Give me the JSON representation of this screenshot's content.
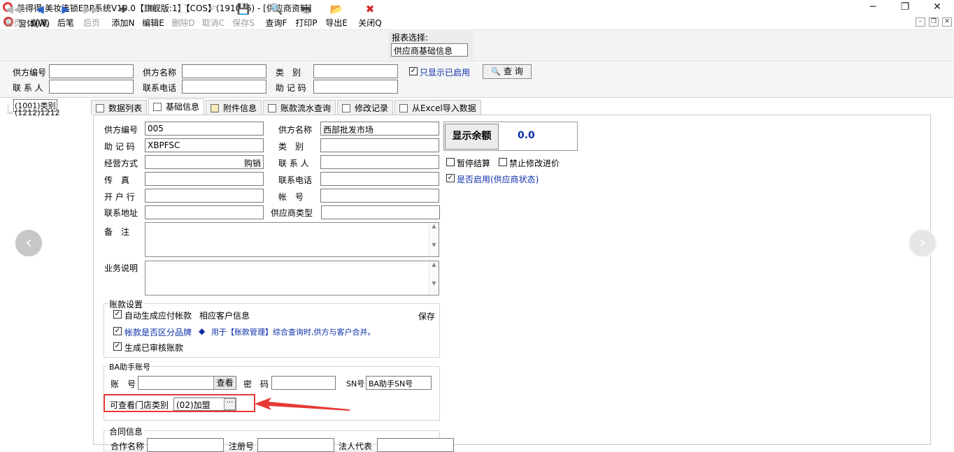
{
  "window": {
    "title": "美得得.美妆连锁ERP系统V10.0【旗舰版:1】【COS】(191016) - [供应商资料]",
    "minimize": "─",
    "restore": "❐",
    "close": "✕"
  },
  "menu": {
    "label": "窗体(W)",
    "mdi_min": "–",
    "mdi_restore": "❐",
    "mdi_close": "✕"
  },
  "toolbar": {
    "items": [
      {
        "label": "前页",
        "icon": "◀◀",
        "disabled": true
      },
      {
        "label": "前笔",
        "icon": "◀",
        "disabled": false
      },
      {
        "label": "后笔",
        "icon": "▶",
        "disabled": false
      },
      {
        "label": "后页",
        "icon": "▶▶",
        "disabled": true
      },
      {
        "label": "添加N",
        "icon": "✚",
        "disabled": false
      },
      {
        "label": "编辑E",
        "icon": "✎",
        "disabled": false
      },
      {
        "label": "删除D",
        "icon": "🗋",
        "disabled": true
      },
      {
        "label": "取消C",
        "icon": "↶",
        "disabled": true
      },
      {
        "label": "保存S",
        "icon": "💾",
        "disabled": true
      },
      {
        "label": "查询F",
        "icon": "🔍",
        "disabled": false
      },
      {
        "label": "打印P",
        "icon": "🖶",
        "disabled": false
      },
      {
        "label": "导出E",
        "icon": "📂",
        "disabled": false
      },
      {
        "label": "关闭Q",
        "icon": "✖",
        "disabled": false
      }
    ],
    "report_label": "报表选择:",
    "report_value": "供应商基础信息"
  },
  "search": {
    "supplier_code_label": "供方编号",
    "supplier_name_label": "供方名称",
    "category_label": "类　别",
    "contact_label": "联 系 人",
    "phone_label": "联系电话",
    "mnemonic_label": "助 记 码",
    "only_enabled_label": "只显示已启用",
    "only_enabled_checked": true,
    "query_button": "查 询"
  },
  "tree": {
    "nodes": [
      "(1001)类别",
      "(1212)1212"
    ]
  },
  "tabs": [
    {
      "label": "数据列表",
      "active": false
    },
    {
      "label": "基础信息",
      "active": true
    },
    {
      "label": "附件信息",
      "active": false
    },
    {
      "label": "账款流水查询",
      "active": false
    },
    {
      "label": "修改记录",
      "active": false
    },
    {
      "label": "从Excel导入数据",
      "active": false
    }
  ],
  "form": {
    "supplier_code_label": "供方编号",
    "supplier_code": "005",
    "supplier_name_label": "供方名称",
    "supplier_name": "西部批发市场",
    "mnemonic_label": "助 记 码",
    "mnemonic": "XBPFSC",
    "category_label": "类　别",
    "category": "",
    "business_mode_label": "经营方式",
    "business_mode": "购销",
    "contact_label": "联 系 人",
    "contact": "",
    "fax_label": "传　真",
    "fax": "",
    "phone_label": "联系电话",
    "phone": "",
    "bank_label": "开 户 行",
    "bank": "",
    "account_label": "帐　号",
    "account": "",
    "address_label": "联系地址",
    "address": "",
    "supplier_type_label": "供应商类型",
    "supplier_type": "",
    "remark_label": "备　注",
    "business_desc_label": "业务说明",
    "show_balance_button": "显示余额",
    "balance_value": "0.0",
    "pause_settle_label": "暂停结算",
    "pause_settle_checked": false,
    "forbid_price_edit_label": "禁止修改进价",
    "forbid_price_edit_checked": false,
    "enabled_label": "是否启用(供应商状态)",
    "enabled_checked": true
  },
  "account_settings": {
    "title": "账款设置",
    "auto_payable_label": "自动生成应付帐款",
    "auto_payable_checked": true,
    "related_customer": "相应客户信息",
    "save": "保存",
    "distinguish_brand_label": "帐款是否区分品牌",
    "distinguish_brand_checked": true,
    "note_diamond": "◆",
    "note": "用于【账款管理】综合查询时,供方与客户合并。",
    "generate_audited_label": "生成已审核账款",
    "generate_audited_checked": true
  },
  "ba_account": {
    "title": "BA助手账号",
    "account_label": "账　号",
    "account": "",
    "view_button": "查看",
    "password_label": "密　码",
    "password": "",
    "sn_label": "SN号",
    "sn_value": "BA助手SN号",
    "store_type_label": "可查看门店类别",
    "store_type_value": "(02)加盟",
    "ellipsis": "···"
  },
  "contract": {
    "title": "合同信息",
    "name_label": "合作名称",
    "reg_no_label": "注册号",
    "legal_rep_label": "法人代表"
  },
  "nav": {
    "prev": "‹",
    "next": "›"
  },
  "colors": {
    "accent_blue": "#0b2ea8",
    "highlight_red": "#e53935"
  }
}
